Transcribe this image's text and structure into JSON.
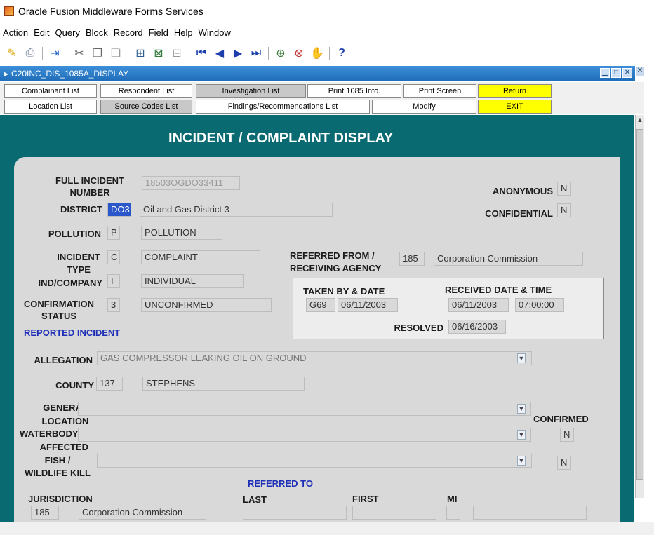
{
  "window_title": "Oracle Fusion Middleware Forms Services",
  "menu": [
    "Action",
    "Edit",
    "Query",
    "Block",
    "Record",
    "Field",
    "Help",
    "Window"
  ],
  "toolbar_icons": [
    "save-icon",
    "print-icon",
    "exit-icon",
    "cut-icon",
    "copy-icon",
    "paste-icon",
    "enter-query-icon",
    "execute-query-icon",
    "cancel-query-icon",
    "first-record-icon",
    "previous-record-icon",
    "next-record-icon",
    "last-record-icon",
    "insert-record-icon",
    "delete-record-icon",
    "lock-record-icon",
    "help-icon"
  ],
  "inner_title": "C20INC_DIS_1085A_DISPLAY",
  "buttons_row1": [
    "Complainant List",
    "Respondent  List",
    "Investigation List",
    "Print 1085  Info.",
    "Print Screen",
    "Return"
  ],
  "buttons_row2": [
    "Location List",
    "Source Codes List",
    "Findings/Recommendations List",
    "Modify",
    "EXIT"
  ],
  "header": "INCIDENT / COMPLAINT DISPLAY",
  "labels": {
    "full_incident_number": "FULL INCIDENT\nNUMBER",
    "district": "DISTRICT",
    "pollution": "POLLUTION",
    "incident_type": "INCIDENT\nTYPE",
    "ind_company": "IND/COMPANY",
    "confirmation_status": "CONFIRMATION\nSTATUS",
    "reported_incident": "REPORTED INCIDENT",
    "anonymous": "ANONYMOUS",
    "confidential": "CONFIDENTIAL",
    "referred_from": "REFERRED FROM /\nRECEIVING AGENCY",
    "taken_by_date": "TAKEN BY & DATE",
    "received_date_time": "RECEIVED DATE & TIME",
    "resolved": "RESOLVED",
    "allegation": "ALLEGATION",
    "county": "COUNTY",
    "general_location": "GENERAL\nLOCATION",
    "waterbody": "WATERBODY",
    "affected": "AFFECTED",
    "fish_wildlife": "FISH /\nWILDLIFE KILL",
    "confirmed": "CONFIRMED",
    "referred_to": "REFERRED TO",
    "jurisdiction": "JURISDICTION",
    "last": "LAST",
    "first": "FIRST",
    "mi": "MI"
  },
  "values": {
    "full_incident_number": "18503OGDO33411",
    "district_code": "DO3",
    "district_name": "Oil and Gas District 3",
    "pollution_code": "P",
    "pollution_name": "POLLUTION",
    "incident_type_code": "C",
    "incident_type_name": "COMPLAINT",
    "ind_company_code": "I",
    "ind_company_name": "INDIVIDUAL",
    "confirmation_code": "3",
    "confirmation_name": "UNCONFIRMED",
    "anonymous": "N",
    "confidential": "N",
    "referred_from_code": "185",
    "referred_from_name": "Corporation Commission",
    "taken_by": "G69",
    "taken_date": "06/11/2003",
    "received_date": "06/11/2003",
    "received_time": "07:00:00",
    "resolved_date": "06/16/2003",
    "allegation": "GAS COMPRESSOR LEAKING OIL ON GROUND",
    "county_code": "137",
    "county_name": "STEPHENS",
    "general_location": "",
    "waterbody": "",
    "waterbody_confirmed": "N",
    "fish_kill": "",
    "fish_kill_confirmed": "N",
    "jurisdiction_code": "185",
    "jurisdiction_name": "Corporation Commission",
    "referred_last": "",
    "referred_first": "",
    "referred_mi": "",
    "referred_extra": ""
  }
}
